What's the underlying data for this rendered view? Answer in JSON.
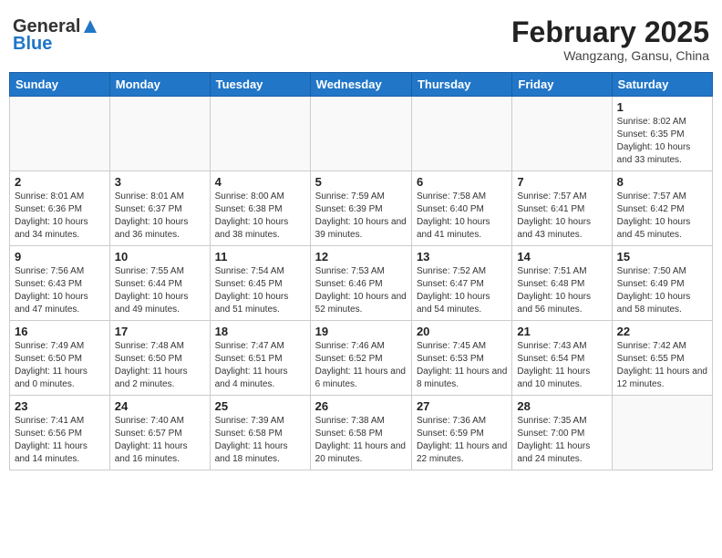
{
  "header": {
    "logo_general": "General",
    "logo_blue": "Blue",
    "title": "February 2025",
    "subtitle": "Wangzang, Gansu, China"
  },
  "columns": [
    "Sunday",
    "Monday",
    "Tuesday",
    "Wednesday",
    "Thursday",
    "Friday",
    "Saturday"
  ],
  "weeks": [
    [
      {
        "day": "",
        "info": ""
      },
      {
        "day": "",
        "info": ""
      },
      {
        "day": "",
        "info": ""
      },
      {
        "day": "",
        "info": ""
      },
      {
        "day": "",
        "info": ""
      },
      {
        "day": "",
        "info": ""
      },
      {
        "day": "1",
        "info": "Sunrise: 8:02 AM\nSunset: 6:35 PM\nDaylight: 10 hours and 33 minutes."
      }
    ],
    [
      {
        "day": "2",
        "info": "Sunrise: 8:01 AM\nSunset: 6:36 PM\nDaylight: 10 hours and 34 minutes."
      },
      {
        "day": "3",
        "info": "Sunrise: 8:01 AM\nSunset: 6:37 PM\nDaylight: 10 hours and 36 minutes."
      },
      {
        "day": "4",
        "info": "Sunrise: 8:00 AM\nSunset: 6:38 PM\nDaylight: 10 hours and 38 minutes."
      },
      {
        "day": "5",
        "info": "Sunrise: 7:59 AM\nSunset: 6:39 PM\nDaylight: 10 hours and 39 minutes."
      },
      {
        "day": "6",
        "info": "Sunrise: 7:58 AM\nSunset: 6:40 PM\nDaylight: 10 hours and 41 minutes."
      },
      {
        "day": "7",
        "info": "Sunrise: 7:57 AM\nSunset: 6:41 PM\nDaylight: 10 hours and 43 minutes."
      },
      {
        "day": "8",
        "info": "Sunrise: 7:57 AM\nSunset: 6:42 PM\nDaylight: 10 hours and 45 minutes."
      }
    ],
    [
      {
        "day": "9",
        "info": "Sunrise: 7:56 AM\nSunset: 6:43 PM\nDaylight: 10 hours and 47 minutes."
      },
      {
        "day": "10",
        "info": "Sunrise: 7:55 AM\nSunset: 6:44 PM\nDaylight: 10 hours and 49 minutes."
      },
      {
        "day": "11",
        "info": "Sunrise: 7:54 AM\nSunset: 6:45 PM\nDaylight: 10 hours and 51 minutes."
      },
      {
        "day": "12",
        "info": "Sunrise: 7:53 AM\nSunset: 6:46 PM\nDaylight: 10 hours and 52 minutes."
      },
      {
        "day": "13",
        "info": "Sunrise: 7:52 AM\nSunset: 6:47 PM\nDaylight: 10 hours and 54 minutes."
      },
      {
        "day": "14",
        "info": "Sunrise: 7:51 AM\nSunset: 6:48 PM\nDaylight: 10 hours and 56 minutes."
      },
      {
        "day": "15",
        "info": "Sunrise: 7:50 AM\nSunset: 6:49 PM\nDaylight: 10 hours and 58 minutes."
      }
    ],
    [
      {
        "day": "16",
        "info": "Sunrise: 7:49 AM\nSunset: 6:50 PM\nDaylight: 11 hours and 0 minutes."
      },
      {
        "day": "17",
        "info": "Sunrise: 7:48 AM\nSunset: 6:50 PM\nDaylight: 11 hours and 2 minutes."
      },
      {
        "day": "18",
        "info": "Sunrise: 7:47 AM\nSunset: 6:51 PM\nDaylight: 11 hours and 4 minutes."
      },
      {
        "day": "19",
        "info": "Sunrise: 7:46 AM\nSunset: 6:52 PM\nDaylight: 11 hours and 6 minutes."
      },
      {
        "day": "20",
        "info": "Sunrise: 7:45 AM\nSunset: 6:53 PM\nDaylight: 11 hours and 8 minutes."
      },
      {
        "day": "21",
        "info": "Sunrise: 7:43 AM\nSunset: 6:54 PM\nDaylight: 11 hours and 10 minutes."
      },
      {
        "day": "22",
        "info": "Sunrise: 7:42 AM\nSunset: 6:55 PM\nDaylight: 11 hours and 12 minutes."
      }
    ],
    [
      {
        "day": "23",
        "info": "Sunrise: 7:41 AM\nSunset: 6:56 PM\nDaylight: 11 hours and 14 minutes."
      },
      {
        "day": "24",
        "info": "Sunrise: 7:40 AM\nSunset: 6:57 PM\nDaylight: 11 hours and 16 minutes."
      },
      {
        "day": "25",
        "info": "Sunrise: 7:39 AM\nSunset: 6:58 PM\nDaylight: 11 hours and 18 minutes."
      },
      {
        "day": "26",
        "info": "Sunrise: 7:38 AM\nSunset: 6:58 PM\nDaylight: 11 hours and 20 minutes."
      },
      {
        "day": "27",
        "info": "Sunrise: 7:36 AM\nSunset: 6:59 PM\nDaylight: 11 hours and 22 minutes."
      },
      {
        "day": "28",
        "info": "Sunrise: 7:35 AM\nSunset: 7:00 PM\nDaylight: 11 hours and 24 minutes."
      },
      {
        "day": "",
        "info": ""
      }
    ]
  ]
}
